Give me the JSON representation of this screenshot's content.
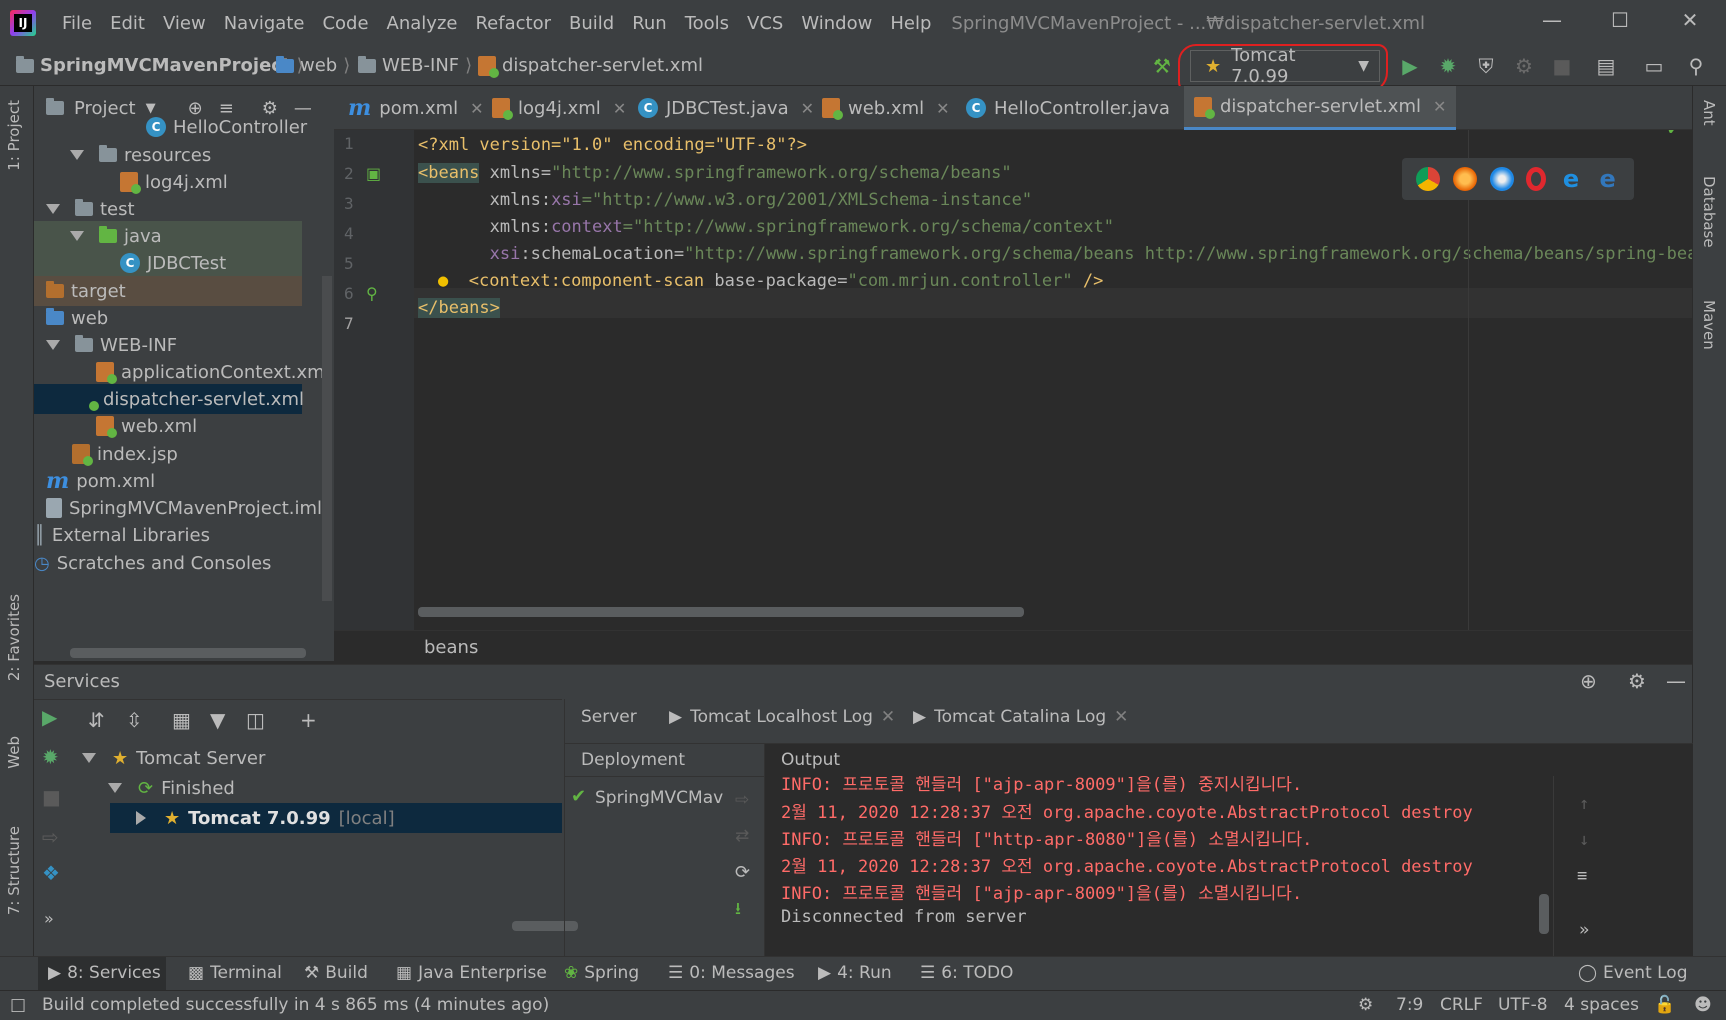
{
  "title_bar": {
    "menus": [
      "File",
      "Edit",
      "View",
      "Navigate",
      "Code",
      "Analyze",
      "Refactor",
      "Build",
      "Run",
      "Tools",
      "VCS",
      "Window",
      "Help"
    ],
    "window_title": "SpringMVCMavenProject - ...₩dispatcher-servlet.xml"
  },
  "nav": {
    "crumbs": [
      "SpringMVCMavenProject",
      "web",
      "WEB-INF",
      "dispatcher-servlet.xml"
    ],
    "run_config": "Tomcat 7.0.99"
  },
  "left_strip": {
    "project": "1: Project",
    "favorites": "2: Favorites",
    "web": "Web",
    "structure": "7: Structure"
  },
  "right_strip": {
    "ant": "Ant",
    "database": "Database",
    "maven": "Maven"
  },
  "project_panel": {
    "header": "Project",
    "tree": [
      "HelloController",
      "resources",
      "log4j.xml",
      "test",
      "java",
      "JDBCTest",
      "target",
      "web",
      "WEB-INF",
      "applicationContext.xml",
      "dispatcher-servlet.xml",
      "web.xml",
      "index.jsp",
      "pom.xml",
      "SpringMVCMavenProject.iml",
      "External Libraries",
      "Scratches and Consoles"
    ]
  },
  "editor": {
    "tabs": [
      "pom.xml",
      "log4j.xml",
      "JDBCTest.java",
      "web.xml",
      "HelloController.java",
      "dispatcher-servlet.xml"
    ],
    "active_tab": "dispatcher-servlet.xml",
    "line_numbers": [
      "1",
      "2",
      "3",
      "4",
      "5",
      "6",
      "7"
    ],
    "code": {
      "l1": "<?xml version=\"1.0\" encoding=\"UTF-8\"?>",
      "l2_tag": "<beans",
      "l2_attr": " xmlns=",
      "l2_val": "\"http://www.springframework.org/schema/beans\"",
      "l3_attr": "       xmlns:",
      "l3_ns": "xsi",
      "l3_val": "=\"http://www.w3.org/2001/XMLSchema-instance\"",
      "l4_attr": "       xmlns:",
      "l4_ns": "context",
      "l4_val": "=\"http://www.springframework.org/schema/context\"",
      "l5_ns": "       xsi",
      "l5_attr": ":schemaLocation=",
      "l5_val": "\"http://www.springframework.org/schema/beans http://www.springframework.org/schema/beans/spring-beans.",
      "l6_tag": "<context",
      "l6_ns": ":component-scan",
      "l6_attr": " base-package=",
      "l6_val": "\"com.mrjun.controller\"",
      "l6_end": " />",
      "l7": "</beans>"
    },
    "breadcrumb": "beans"
  },
  "services": {
    "title": "Services",
    "tree": {
      "server": "Tomcat Server",
      "finished": "Finished",
      "instance": "Tomcat 7.0.99",
      "instance_suffix": "[local]"
    },
    "tabs": [
      "Server",
      "Tomcat Localhost Log",
      "Tomcat Catalina Log"
    ],
    "deployment_header": "Deployment",
    "output_header": "Output",
    "deployment_item": "SpringMVCMav",
    "output_lines": [
      "INFO: 프로토콜 핸들러 [\"ajp-apr-8009\"]을(를) 중지시킵니다.",
      "2월 11, 2020 12:28:37 오전 org.apache.coyote.AbstractProtocol destroy",
      "INFO: 프로토콜 핸들러 [\"http-apr-8080\"]을(를) 소멸시킵니다.",
      "2월 11, 2020 12:28:37 오전 org.apache.coyote.AbstractProtocol destroy",
      "INFO: 프로토콜 핸들러 [\"ajp-apr-8009\"]을(를) 소멸시킵니다.",
      "Disconnected from server"
    ]
  },
  "bottom_tabs": [
    "8: Services",
    "Terminal",
    "Build",
    "Java Enterprise",
    "Spring",
    "0: Messages",
    "4: Run",
    "6: TODO",
    "Event Log"
  ],
  "status": {
    "message": "Build completed successfully in 4 s 865 ms (4 minutes ago)",
    "position": "7:9",
    "line_sep": "CRLF",
    "encoding": "UTF-8",
    "indent": "4 spaces"
  }
}
